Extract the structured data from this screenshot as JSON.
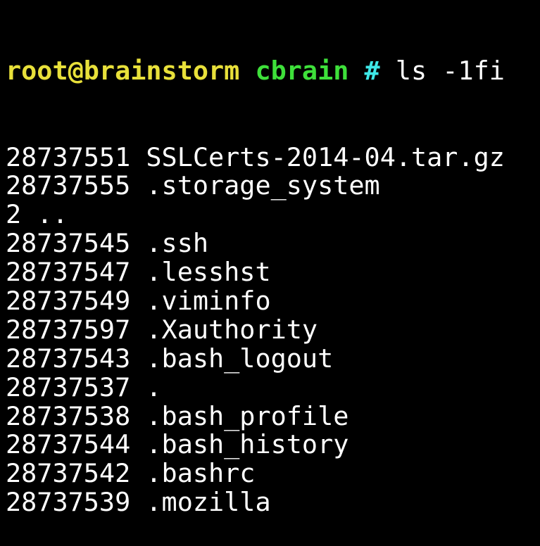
{
  "colors": {
    "user": "#e8e03a",
    "directory": "#3ee03a",
    "prompt_symbol": "#3ee8e8",
    "text": "#ffffff",
    "background": "#000000"
  },
  "prompt": {
    "user_host": "root@brainstorm",
    "directory": "cbrain",
    "symbol": "#",
    "command": "ls -1fi"
  },
  "output": [
    {
      "inode": "28737551",
      "name": "SSLCerts-2014-04.tar.gz"
    },
    {
      "inode": "28737555",
      "name": ".storage_system"
    },
    {
      "inode": "2",
      "name": ".."
    },
    {
      "inode": "28737545",
      "name": ".ssh"
    },
    {
      "inode": "28737547",
      "name": ".lesshst"
    },
    {
      "inode": "28737549",
      "name": ".viminfo"
    },
    {
      "inode": "28737597",
      "name": ".Xauthority"
    },
    {
      "inode": "28737543",
      "name": ".bash_logout"
    },
    {
      "inode": "28737537",
      "name": "."
    },
    {
      "inode": "28737538",
      "name": ".bash_profile"
    },
    {
      "inode": "28737544",
      "name": ".bash_history"
    },
    {
      "inode": "28737542",
      "name": ".bashrc"
    },
    {
      "inode": "28737539",
      "name": ".mozilla"
    }
  ]
}
